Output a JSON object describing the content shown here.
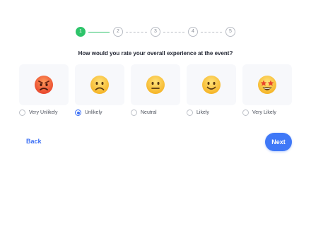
{
  "stepper": {
    "steps": [
      {
        "label": "1",
        "state": "active"
      },
      {
        "label": "2",
        "state": "todo"
      },
      {
        "label": "3",
        "state": "todo"
      },
      {
        "label": "4",
        "state": "todo"
      },
      {
        "label": "5",
        "state": "todo"
      }
    ],
    "active_color": "#2ec46a"
  },
  "question": "How would you rate your overall experience at the event?",
  "options": [
    {
      "label": "Very Unlikely",
      "icon": "angry-face-icon",
      "selected": false
    },
    {
      "label": "Unlikely",
      "icon": "frowning-face-icon",
      "selected": true
    },
    {
      "label": "Neutral",
      "icon": "neutral-face-icon",
      "selected": false
    },
    {
      "label": "Likely",
      "icon": "slightly-smiling-face-icon",
      "selected": false
    },
    {
      "label": "Very Likely",
      "icon": "star-struck-face-icon",
      "selected": false
    }
  ],
  "nav": {
    "back_label": "Back",
    "next_label": "Next",
    "accent_color": "#3b6ff5"
  }
}
